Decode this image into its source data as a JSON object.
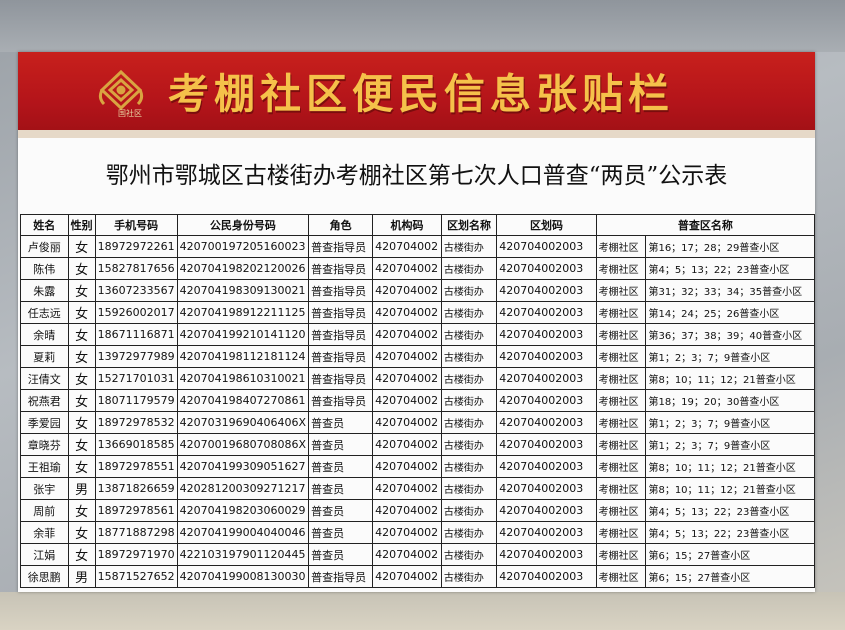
{
  "banner": {
    "title": "考棚社区便民信息张贴栏",
    "logo_text": "国社区"
  },
  "document": {
    "title": "鄂州市鄂城区古楼街办考棚社区第七次人口普查“两员”公示表"
  },
  "table": {
    "headers": [
      "姓名",
      "性别",
      "手机号码",
      "公民身份号码",
      "角色",
      "机构码",
      "区划名称",
      "区划码",
      "普查区名称"
    ],
    "rows": [
      {
        "name": "卢俊丽",
        "sex": "女",
        "phone": "18972972261",
        "id": "420700197205160023",
        "role": "普查指导员",
        "org": "420704002",
        "district": "古楼街办",
        "code": "420704002003",
        "community": "考棚社区",
        "area": "第16；17；28；29普查小区"
      },
      {
        "name": "陈伟",
        "sex": "女",
        "phone": "15827817656",
        "id": "420704198202120026",
        "role": "普查指导员",
        "org": "420704002",
        "district": "古楼街办",
        "code": "420704002003",
        "community": "考棚社区",
        "area": "第4；5；13；22；23普查小区"
      },
      {
        "name": "朱露",
        "sex": "女",
        "phone": "13607233567",
        "id": "420704198309130021",
        "role": "普查指导员",
        "org": "420704002",
        "district": "古楼街办",
        "code": "420704002003",
        "community": "考棚社区",
        "area": "第31；32；33；34；35普查小区"
      },
      {
        "name": "任志远",
        "sex": "女",
        "phone": "15926002017",
        "id": "420704198912211125",
        "role": "普查指导员",
        "org": "420704002",
        "district": "古楼街办",
        "code": "420704002003",
        "community": "考棚社区",
        "area": "第14；24；25；26普查小区"
      },
      {
        "name": "余晴",
        "sex": "女",
        "phone": "18671116871",
        "id": "420704199210141120",
        "role": "普查指导员",
        "org": "420704002",
        "district": "古楼街办",
        "code": "420704002003",
        "community": "考棚社区",
        "area": "第36；37；38；39；40普查小区"
      },
      {
        "name": "夏莉",
        "sex": "女",
        "phone": "13972977989",
        "id": "420704198112181124",
        "role": "普查指导员",
        "org": "420704002",
        "district": "古楼街办",
        "code": "420704002003",
        "community": "考棚社区",
        "area": "第1；2；3；7；9普查小区"
      },
      {
        "name": "汪倩文",
        "sex": "女",
        "phone": "15271701031",
        "id": "420704198610310021",
        "role": "普查指导员",
        "org": "420704002",
        "district": "古楼街办",
        "code": "420704002003",
        "community": "考棚社区",
        "area": "第8；10；11；12；21普查小区"
      },
      {
        "name": "祝燕君",
        "sex": "女",
        "phone": "18071179579",
        "id": "420704198407270861",
        "role": "普查指导员",
        "org": "420704002",
        "district": "古楼街办",
        "code": "420704002003",
        "community": "考棚社区",
        "area": "第18；19；20；30普查小区"
      },
      {
        "name": "季爱园",
        "sex": "女",
        "phone": "18972978532",
        "id": "42070319690406406X",
        "role": "普查员",
        "org": "420704002",
        "district": "古楼街办",
        "code": "420704002003",
        "community": "考棚社区",
        "area": "第1；2；3；7；9普查小区"
      },
      {
        "name": "章晓芬",
        "sex": "女",
        "phone": "13669018585",
        "id": "42070019680708086X",
        "role": "普查员",
        "org": "420704002",
        "district": "古楼街办",
        "code": "420704002003",
        "community": "考棚社区",
        "area": "第1；2；3；7；9普查小区"
      },
      {
        "name": "王祖瑜",
        "sex": "女",
        "phone": "18972978551",
        "id": "420704199309051627",
        "role": "普查员",
        "org": "420704002",
        "district": "古楼街办",
        "code": "420704002003",
        "community": "考棚社区",
        "area": "第8；10；11；12；21普查小区"
      },
      {
        "name": "张宇",
        "sex": "男",
        "phone": "13871826659",
        "id": "420281200309271217",
        "role": "普查员",
        "org": "420704002",
        "district": "古楼街办",
        "code": "420704002003",
        "community": "考棚社区",
        "area": "第8；10；11；12；21普查小区"
      },
      {
        "name": "周前",
        "sex": "女",
        "phone": "18972978561",
        "id": "420704198203060029",
        "role": "普查员",
        "org": "420704002",
        "district": "古楼街办",
        "code": "420704002003",
        "community": "考棚社区",
        "area": "第4；5；13；22；23普查小区"
      },
      {
        "name": "余菲",
        "sex": "女",
        "phone": "18771887298",
        "id": "420704199004040046",
        "role": "普查员",
        "org": "420704002",
        "district": "古楼街办",
        "code": "420704002003",
        "community": "考棚社区",
        "area": "第4；5；13；22；23普查小区"
      },
      {
        "name": "江娟",
        "sex": "女",
        "phone": "18972971970",
        "id": "422103197901120445",
        "role": "普查员",
        "org": "420704002",
        "district": "古楼街办",
        "code": "420704002003",
        "community": "考棚社区",
        "area": "第6；15；27普查小区"
      },
      {
        "name": "徐思鹏",
        "sex": "男",
        "phone": "15871527652",
        "id": "420704199008130030",
        "role": "普查指导员",
        "org": "420704002",
        "district": "古楼街办",
        "code": "420704002003",
        "community": "考棚社区",
        "area": "第6；15；27普查小区"
      }
    ]
  },
  "colors": {
    "banner_red": "#c8201c",
    "banner_title": "#f5c14a",
    "logo_gold": "#d9a441"
  }
}
